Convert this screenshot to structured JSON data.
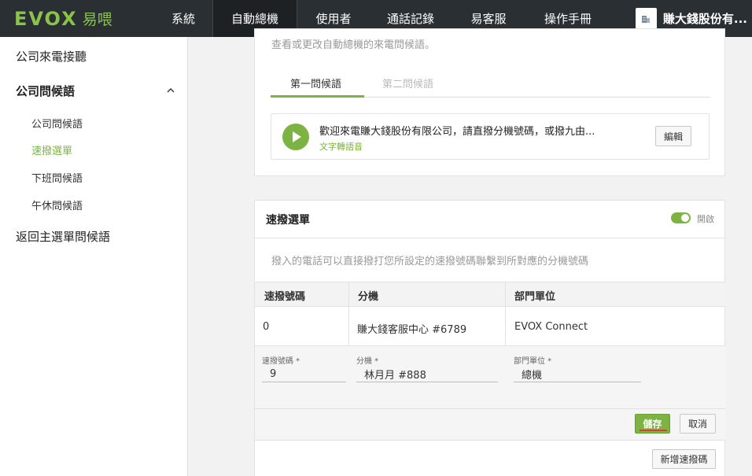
{
  "header": {
    "logo_text": "EVOX",
    "logo_cn": "易喂",
    "nav": [
      "系統",
      "自動總機",
      "使用者",
      "通話記錄",
      "易客服",
      "操作手冊"
    ],
    "company": "賺大錢股份有..."
  },
  "sidebar": {
    "items": [
      "公司來電接聽",
      "公司問候語",
      "返回主選單問候語"
    ],
    "subitems": [
      "公司問候語",
      "速撥選單",
      "下班問候語",
      "午休問候語"
    ]
  },
  "greeting": {
    "desc": "查看或更改自動總機的來電問候語。",
    "tabs": [
      "第一問候語",
      "第二問候語"
    ],
    "message": "歡迎來電賺大錢股份有限公司，請直撥分機號碼，或撥九由...",
    "type": "文字轉語音",
    "edit_label": "編輯"
  },
  "speed_dial": {
    "title": "速撥選單",
    "toggle_label": "開啟",
    "desc": "撥入的電話可以直接撥打您所設定的速撥號碼聯繫到所對應的分機號碼",
    "columns": [
      "速撥號碼",
      "分機",
      "部門單位"
    ],
    "rows": [
      [
        "0",
        "賺大錢客服中心 #6789",
        "EVOX Connect"
      ]
    ],
    "form": {
      "labels": [
        "速撥號碼 *",
        "分機 *",
        "部門單位 *"
      ],
      "values": [
        "9",
        "林月月 #888",
        "總機"
      ]
    },
    "save_label": "儲存",
    "cancel_label": "取消",
    "add_label": "新增速撥碼"
  },
  "colors": {
    "accent": "#7cb342",
    "nav_bg": "#2a2f33"
  }
}
